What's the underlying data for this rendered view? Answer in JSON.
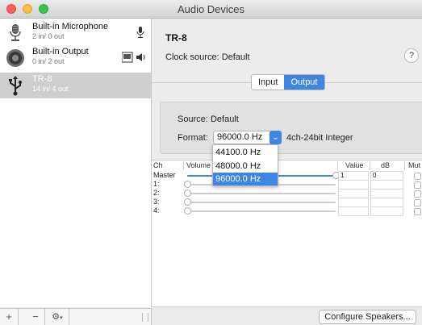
{
  "window": {
    "title": "Audio Devices"
  },
  "sidebar": {
    "devices": [
      {
        "name": "Built-in Microphone",
        "channels": "2 in/ 0 out"
      },
      {
        "name": "Built-in Output",
        "channels": "0 in/ 2 out"
      },
      {
        "name": "TR-8",
        "channels": "14 in/ 4 out"
      }
    ]
  },
  "main": {
    "device_title": "TR-8",
    "clock_source": "Clock source: Default",
    "help": "?",
    "tabs": [
      "Input",
      "Output"
    ],
    "selected_tab": "Output",
    "source": "Source: Default",
    "format_label": "Format:",
    "format_value": "96000.0 Hz",
    "format_desc": "4ch-24bit Integer",
    "format_options": [
      "44100.0 Hz",
      "48000.0 Hz",
      "96000.0 Hz"
    ],
    "table": {
      "headers": [
        "Ch",
        "Volume",
        "Value",
        "dB",
        "Mut"
      ],
      "rows": [
        {
          "ch": "Master",
          "value": "1",
          "db": "0",
          "level": 1.0
        },
        {
          "ch": "1:",
          "value": "",
          "db": "",
          "level": 0
        },
        {
          "ch": "2:",
          "value": "",
          "db": "",
          "level": 0
        },
        {
          "ch": "3:",
          "value": "",
          "db": "",
          "level": 0
        },
        {
          "ch": "4:",
          "value": "",
          "db": "",
          "level": 0
        }
      ]
    },
    "configure_button": "Configure Speakers..."
  },
  "bottom_bar": {
    "add": "+",
    "remove": "−",
    "gear": "⚙"
  },
  "colors": {
    "accent": "#3e86e3",
    "selected_row": "#cecece"
  }
}
